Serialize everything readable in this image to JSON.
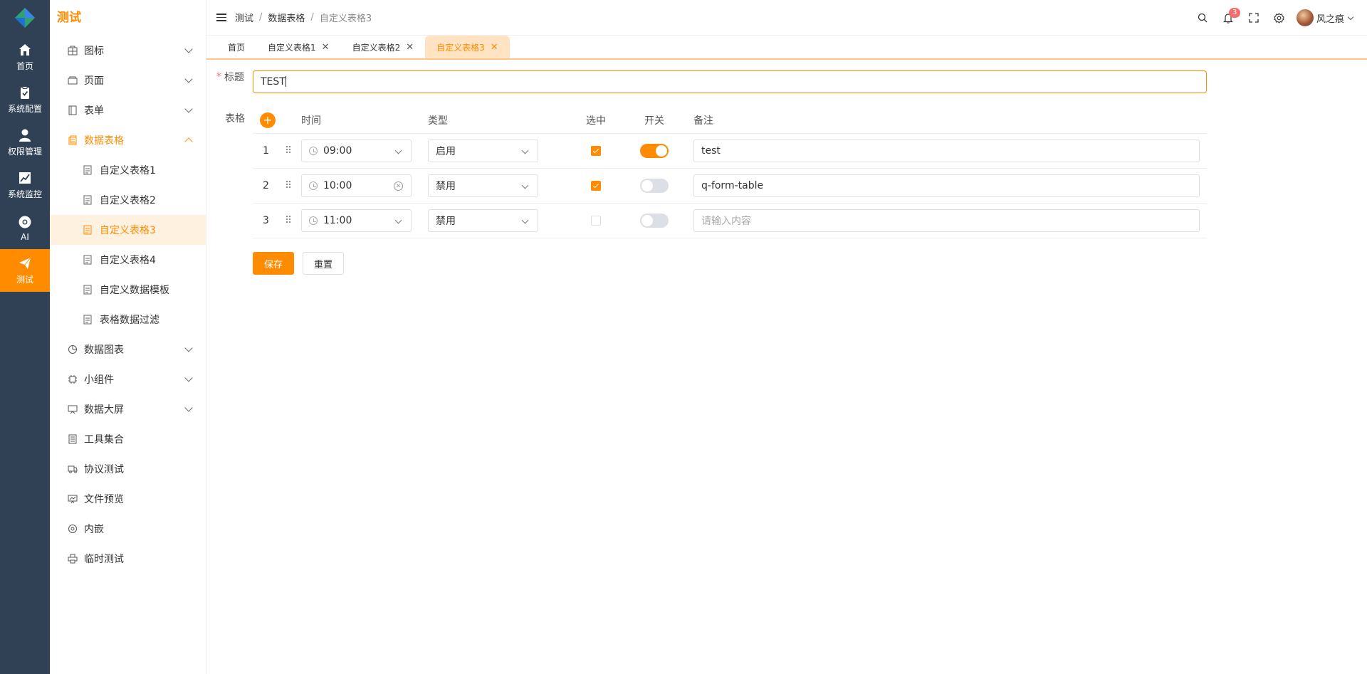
{
  "rail": {
    "items": [
      {
        "label": "首页",
        "icon": "home-icon"
      },
      {
        "label": "系统配置",
        "icon": "clipboard-icon"
      },
      {
        "label": "权限管理",
        "icon": "user-icon"
      },
      {
        "label": "系统监控",
        "icon": "chart-line-icon"
      },
      {
        "label": "AI",
        "icon": "chrome-icon"
      },
      {
        "label": "测试",
        "icon": "paper-plane-icon",
        "active": true
      }
    ]
  },
  "sidebar": {
    "title": "测试",
    "menu": [
      {
        "label": "图标",
        "icon": "grid-icon"
      },
      {
        "label": "页面",
        "icon": "window-icon"
      },
      {
        "label": "表单",
        "icon": "book-icon"
      },
      {
        "label": "数据表格",
        "icon": "table-icon",
        "open": true
      },
      {
        "label": "数据图表",
        "icon": "pie-chart-icon"
      },
      {
        "label": "小组件",
        "icon": "chip-icon"
      },
      {
        "label": "数据大屏",
        "icon": "monitor-icon"
      },
      {
        "label": "工具集合",
        "icon": "document-icon"
      },
      {
        "label": "协议测试",
        "icon": "truck-icon"
      },
      {
        "label": "文件预览",
        "icon": "presentation-icon"
      },
      {
        "label": "内嵌",
        "icon": "globe-icon"
      },
      {
        "label": "临时测试",
        "icon": "printer-icon"
      }
    ],
    "submenu": [
      {
        "label": "自定义表格1"
      },
      {
        "label": "自定义表格2"
      },
      {
        "label": "自定义表格3",
        "active": true
      },
      {
        "label": "自定义表格4"
      },
      {
        "label": "自定义数据模板"
      },
      {
        "label": "表格数据过滤"
      }
    ]
  },
  "header": {
    "breadcrumb": [
      "测试",
      "数据表格",
      "自定义表格3"
    ],
    "notification_count": "3",
    "username": "风之痕"
  },
  "tabs": [
    {
      "label": "首页",
      "closable": false
    },
    {
      "label": "自定义表格1",
      "closable": true
    },
    {
      "label": "自定义表格2",
      "closable": true
    },
    {
      "label": "自定义表格3",
      "closable": true,
      "active": true
    }
  ],
  "form": {
    "title_label": "标题",
    "title_value": "TEST",
    "table_label": "表格",
    "columns": {
      "time": "时间",
      "type": "类型",
      "selected": "选中",
      "switch": "开关",
      "note": "备注"
    },
    "rows": [
      {
        "index": "1",
        "time": "09:00",
        "type": "启用",
        "checked": true,
        "switch": true,
        "note": "test",
        "placeholder": ""
      },
      {
        "index": "2",
        "time": "10:00",
        "type": "禁用",
        "checked": true,
        "switch": false,
        "note": "q-form-table",
        "placeholder": "",
        "clearable": true
      },
      {
        "index": "3",
        "time": "11:00",
        "type": "禁用",
        "checked": false,
        "switch": false,
        "note": "",
        "placeholder": "请输入内容"
      }
    ],
    "save_label": "保存",
    "reset_label": "重置"
  },
  "colors": {
    "accent": "#ff8c00",
    "rail_bg": "#304156",
    "tab_active_bg": "#ffe3c2"
  }
}
